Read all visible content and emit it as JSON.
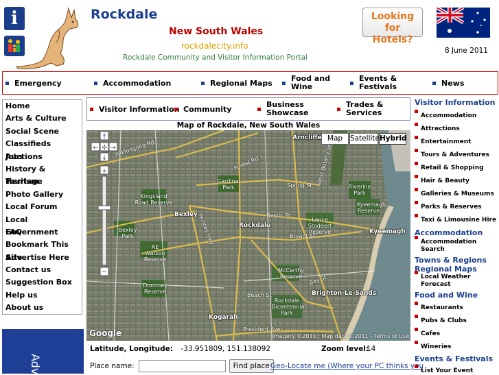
{
  "header": {
    "title": "Rockdale",
    "state": "New South Wales",
    "domain": "rockdalecity.info",
    "tagline": "Rockdale Community and Visitor Information Portal",
    "hotels_line1": "Looking for",
    "hotels_line2": "Hotels?",
    "date": "8 June 2011"
  },
  "main_nav": [
    "Emergency",
    "Accommodation",
    "Regional Maps",
    "Food and Wine",
    "Events & Festivals",
    "News"
  ],
  "left_nav": [
    "Home",
    "Arts & Culture",
    "Social Scene",
    "Classifieds Auctions",
    "Jobs",
    "History & Heritage",
    "Tourism",
    "Photo Gallery",
    "Local Forum",
    "Local Government",
    "FAQ",
    "Bookmark This Site",
    "Advertise Here",
    "Contact us",
    "Suggestion Box",
    "Help us",
    "About us"
  ],
  "advert_text": "Adv",
  "sub_nav": [
    "Visitor Information",
    "Community",
    "Business Showcase",
    "Trades & Services"
  ],
  "map": {
    "title": "Map of Rockdale, New South Wales",
    "types": [
      "Map",
      "Satellite",
      "Hybrid"
    ],
    "active_type": "Hybrid",
    "logo": "Google",
    "copyright": "Imagery ©2011 , Map data ©2011 - Terms of Use",
    "places": [
      "Arncliffe",
      "Bexley",
      "Rockdale",
      "Kogarah",
      "Brighton-Le-Sands",
      "Kyeemagh"
    ],
    "parks": [
      "Gardiner Park",
      "Riverine Park",
      "Kingsland Road Reserve",
      "Kyeemagh Reserve",
      "Bexley Park",
      "Lance Stoddert Reserve",
      "AE Watson Reserve",
      "McCarthy Reserve",
      "Dominey Reserve",
      "Rockdale Bicentennial Park"
    ],
    "roads": [
      "Wollongong Rd",
      "Forest Rd",
      "Spring St",
      "Bestic St",
      "Bryant St",
      "Bay St",
      "Beach St",
      "President Ave",
      "Princes Hwy",
      "West Botany St"
    ]
  },
  "coords": {
    "label": "Latitude, Longitude:",
    "value": "-33.951809, 151.138092",
    "zoom_label": "Zoom level:",
    "zoom": "14"
  },
  "search": {
    "label": "Place name:",
    "placeholder": "",
    "button": "Find place",
    "geo_link": "Geo-Locate me (Where your PC thinks you"
  },
  "right_nav": [
    {
      "head": "Visitor Information",
      "items": [
        "Accommodation",
        "Attractions",
        "Entertainment",
        "Tours & Adventures",
        "Retail & Shopping",
        "Hair & Beauty",
        "Galleries & Museums",
        "Parks & Reserves",
        "Taxi & Limousine Hire"
      ]
    },
    {
      "head": "Accommodation",
      "items": [
        "Accommodation Search"
      ]
    },
    {
      "head": "Towns & Regions",
      "items": []
    },
    {
      "head": "Regional Maps",
      "items": [
        "Local Weather Forecast"
      ]
    },
    {
      "head": "Food and Wine",
      "items": [
        "Restaurants",
        "Pubs & Clubs",
        "Cafes",
        "Wineries"
      ]
    },
    {
      "head": "Events & Festivals",
      "items": [
        "List Your Event"
      ]
    }
  ],
  "colors": {
    "brand_blue": "#1c3f8f",
    "accent_red": "#c00000",
    "accent_orange": "#e8771f",
    "green": "#2f7a3a"
  }
}
